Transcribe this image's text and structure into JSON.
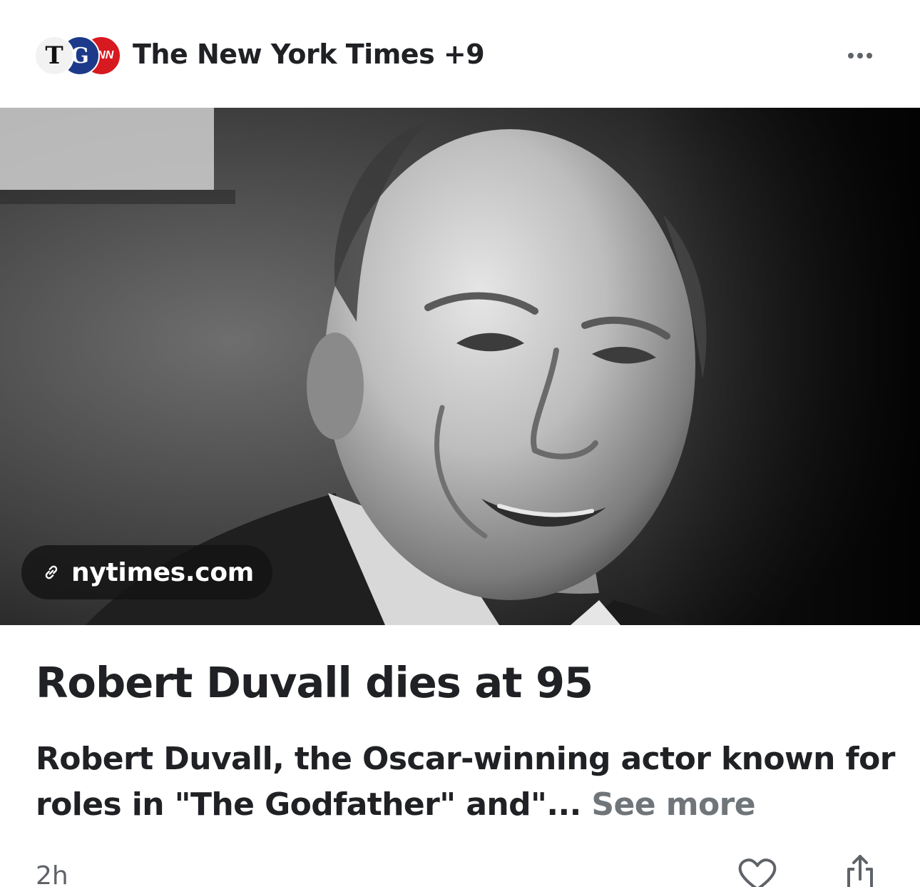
{
  "header": {
    "source_logos": [
      "nyt-logo",
      "g-logo",
      "cnn-logo"
    ],
    "logo_nyt_text": "T",
    "logo_g_text": "G",
    "logo_cnn_text": "CNN",
    "source_title": "The New York Times +9",
    "more_icon": "more-horizontal-icon"
  },
  "media": {
    "image_subject": "portrait-photo",
    "link_icon": "link-icon",
    "link_label": "nytimes.com"
  },
  "article": {
    "headline": "Robert Duvall dies at 95",
    "summary": "Robert Duvall, the Oscar-winning actor known for roles in \"The Godfather\" and\"...",
    "see_more": "See more"
  },
  "footer": {
    "timestamp": "2h",
    "like_icon": "heart-icon",
    "share_icon": "share-icon"
  },
  "colors": {
    "text_primary": "#202124",
    "text_secondary": "#70757a",
    "chip_background": "#141414",
    "cnn_red": "#d71920"
  }
}
